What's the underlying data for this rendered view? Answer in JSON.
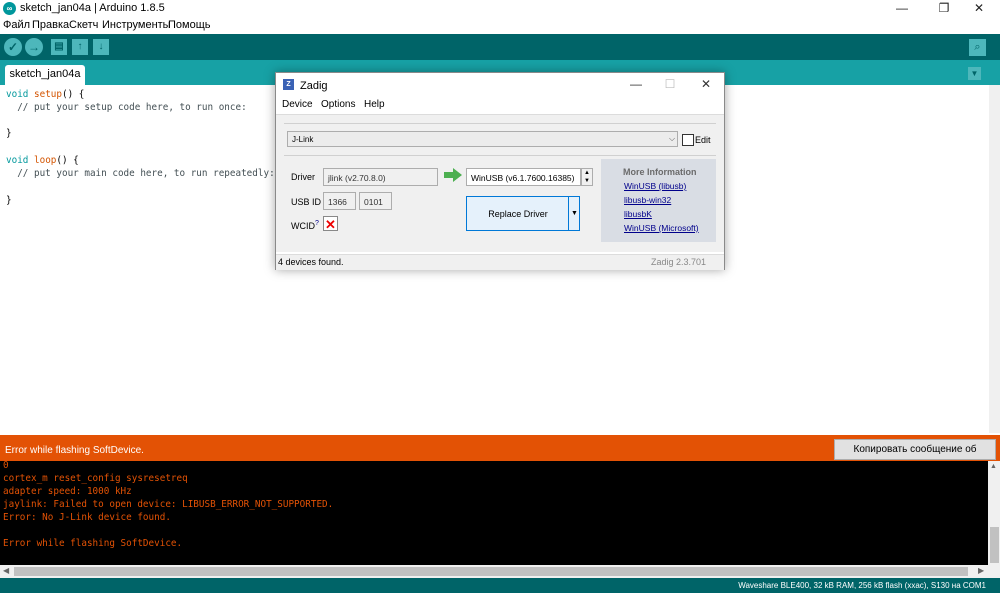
{
  "window": {
    "title": "sketch_jan04a | Arduino 1.8.5",
    "controls": {
      "minimize": "—",
      "maximize": "❐",
      "close": "✕"
    }
  },
  "menu": [
    "Файл",
    "Правка",
    "Скетч",
    "Инструменты",
    "Помощь"
  ],
  "toolbar": {
    "icons": [
      "verify-icon",
      "upload-icon",
      "new-icon",
      "open-icon",
      "save-icon",
      "serial-monitor-icon"
    ]
  },
  "tabs": {
    "active": "sketch_jan04a"
  },
  "editor": {
    "lines": [
      {
        "kw": "void",
        "fn": "setup",
        "rest": "() {"
      },
      {
        "cm": "  // put your setup code here, to run once:"
      },
      {
        "text": ""
      },
      {
        "text": "}"
      },
      {
        "text": ""
      },
      {
        "kw": "void",
        "fn": "loop",
        "rest": "() {"
      },
      {
        "cm": "  // put your main code here, to run repeatedly:"
      },
      {
        "text": ""
      },
      {
        "text": "}"
      }
    ]
  },
  "error_band": {
    "message": "Error while flashing SoftDevice.",
    "copy_button": "Копировать сообщение об ошибке"
  },
  "console": {
    "lines": [
      "0",
      "cortex_m reset_config sysresetreq",
      "adapter speed: 1000 kHz",
      "jaylink: Failed to open device: LIBUSB_ERROR_NOT_SUPPORTED.",
      "Error: No J-Link device found.",
      "",
      "Error while flashing SoftDevice."
    ]
  },
  "statusbar": {
    "board": "Waveshare BLE400, 32 kB RAM, 256 kB flash (xxac), S130 на COM1"
  },
  "zadig": {
    "title": "Zadig",
    "menu": [
      "Device",
      "Options",
      "Help"
    ],
    "device": "J-Link",
    "edit_label": "Edit",
    "driver_label": "Driver",
    "driver_current": "jlink (v2.70.8.0)",
    "driver_target": "WinUSB (v6.1.7600.16385)",
    "usb_id_label": "USB ID",
    "usb_vid": "1366",
    "usb_pid": "0101",
    "wcid_label": "WCID",
    "wcid_sup": "?",
    "replace_button": "Replace Driver",
    "more_info_title": "More Information",
    "links": [
      "WinUSB (libusb)",
      "libusb-win32",
      "libusbK",
      "WinUSB (Microsoft)"
    ],
    "status": "4 devices found.",
    "version": "Zadig 2.3.701"
  },
  "colors": {
    "arduino_dark": "#006468",
    "arduino_tab": "#17a1a5",
    "error_orange": "#e35205"
  }
}
